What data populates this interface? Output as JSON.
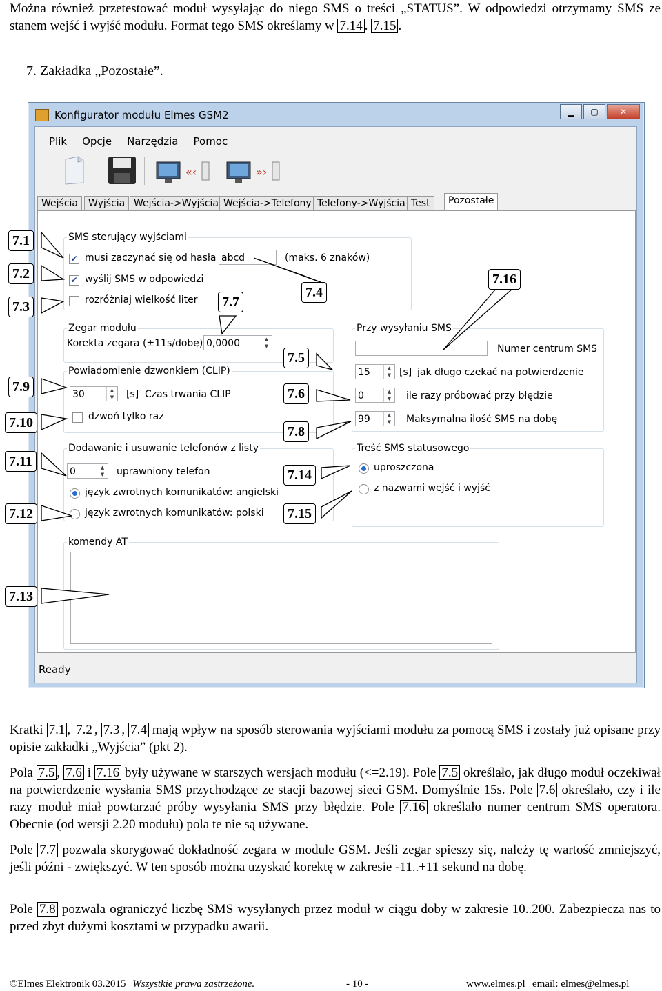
{
  "intro": {
    "text_a": "Można również przetestować moduł wysyłając do niego SMS o treści „STATUS”. W odpowiedzi otrzymamy SMS ze stanem wejść i wyjść modułu. Format tego SMS określamy w ",
    "ref1": "7.14",
    "sep": ".",
    "ref2": "7.15",
    "end": "."
  },
  "heading": "7.  Zakładka „Pozostałe”.",
  "window": {
    "title": "Konfigurator modułu Elmes GSM2",
    "menu": [
      "Plik",
      "Opcje",
      "Narzędzia",
      "Pomoc"
    ],
    "tabs": [
      "Wejścia",
      "Wyjścia",
      "Wejścia->Wyjścia",
      "Wejścia->Telefony",
      "Telefony->Wyjścia",
      "Test",
      "Pozostałe"
    ],
    "sms_group": {
      "title": "SMS sterujący wyjściami",
      "password_label": "musi zaczynać się od hasła",
      "password_value": "abcd",
      "max_note": "(maks. 6 znaków)",
      "reply_label": "wyślij SMS w odpowiedzi",
      "case_label": "rozróżniaj wielkość liter"
    },
    "clock_group": {
      "title": "Zegar modułu",
      "label": "Korekta zegara (±11s/dobę)",
      "value": "0,0000"
    },
    "clip_group": {
      "title": "Powiadomienie dzwonkiem (CLIP)",
      "value": "30",
      "unit": "[s]",
      "label": "Czas trwania CLIP",
      "ring_label": "dzwoń tylko raz"
    },
    "phones_group": {
      "title": "Dodawanie i usuwanie telefonów z listy",
      "value": "0",
      "label": "uprawniony telefon",
      "lang_en": "język zwrotnych komunikatów: angielski",
      "lang_pl": "język zwrotnych komunikatów: polski"
    },
    "sending_group": {
      "title": "Przy wysyłaniu SMS",
      "center_label": "Numer centrum SMS",
      "wait_value": "15",
      "wait_unit": "[s]",
      "wait_label": "jak długo czekać na potwierdzenie",
      "retry_value": "0",
      "retry_label": "ile razy próbować przy błędzie",
      "max_value": "99",
      "max_label": "Maksymalna ilość SMS na dobę"
    },
    "status_group": {
      "title": "Treść SMS statusowego",
      "opt1": "uproszczona",
      "opt2": "z nazwami wejść i wyjść"
    },
    "at_group": {
      "title": "komendy AT"
    },
    "status": "Ready"
  },
  "callouts": [
    "7.1",
    "7.2",
    "7.3",
    "7.4",
    "7.5",
    "7.6",
    "7.7",
    "7.8",
    "7.9",
    "7.10",
    "7.11",
    "7.12",
    "7.13",
    "7.14",
    "7.15",
    "7.16"
  ],
  "para1": {
    "a": "Kratki ",
    "r1": "7.1",
    "s1": ", ",
    "r2": "7.2",
    "s2": ", ",
    "r3": "7.3",
    "s3": ", ",
    "r4": "7.4",
    "b": " mają wpływ na sposób sterowania wyjściami modułu za pomocą SMS i zostały już opisane przy opisie zakładki „Wyjścia” (pkt 2)."
  },
  "para2": {
    "a": "Pola ",
    "r1": "7.5",
    "s1": ", ",
    "r2": "7.6",
    "s2": " i ",
    "r3": "7.16",
    "b": " były używane w starszych wersjach modułu (<=2.19). Pole ",
    "r4": "7.5",
    "c": " określało, jak długo moduł oczekiwał na potwierdzenie wysłania SMS przychodzące ze stacji bazowej sieci GSM. Domyślnie 15s. Pole ",
    "r5": "7.6",
    "d": " określało, czy i ile razy moduł miał powtarzać próby wysyłania SMS przy błędzie. Pole ",
    "r6": "7.16",
    "e": " określało numer centrum SMS operatora. Obecnie (od wersji 2.20 modułu) pola te nie są używane."
  },
  "para3": {
    "a": "Pole ",
    "r1": "7.7",
    "b": " pozwala skorygować dokładność zegara w module GSM. Jeśli zegar spieszy się, należy tę wartość zmniejszyć, jeśli późni - zwiększyć. W ten sposób można uzyskać korektę w zakresie -11..+11 sekund na dobę."
  },
  "para4": {
    "a": "Pole ",
    "r1": "7.8",
    "b": " pozwala ograniczyć liczbę SMS wysyłanych przez moduł w ciągu doby w zakresie 10..200. Zabezpiecza nas to przed zbyt dużymi kosztami w przypadku awarii."
  },
  "footer": {
    "copyright": "©Elmes Elektronik 03.2015",
    "rights": "Wszystkie prawa zastrzeżone.",
    "page": "- 10 -",
    "site": "www.elmes.pl",
    "email_label": "email: ",
    "email": "elmes@elmes.pl"
  }
}
